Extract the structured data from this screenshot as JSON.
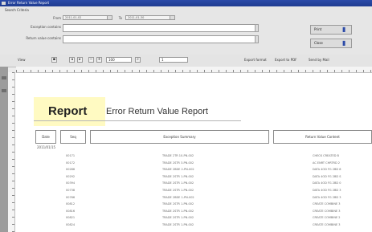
{
  "window": {
    "title": "Error Return Value Report"
  },
  "params": {
    "group_label": "Search Criteria",
    "from_label": "From",
    "from_value": "2011-01-02",
    "to_label": "To",
    "to_value": "2011-01-30",
    "exception_label": "Exception contains",
    "return_label": "Return value contains",
    "print_button": "Print",
    "close_button": "Close"
  },
  "toolbar": {
    "view_label": "View",
    "zoom_value": "100",
    "page_value": "1",
    "export_label": "Export format",
    "export_pdf": "Export to PDF",
    "send_label": "Send by Mail"
  },
  "report": {
    "badge": "Report",
    "title": "Error Return Value Report",
    "columns": [
      "Date",
      "Seq",
      "Exception Summary",
      "Return Value Content"
    ],
    "group": "2011/01/15",
    "rows": [
      {
        "seq": "00171",
        "exception": "TRADE 2TR 10-PN-002",
        "returned": "CHECK CREATED B"
      },
      {
        "seq": "00172",
        "exception": "TRADE 2STR 3-PN-002",
        "returned": "AC ENRT CHRTRD 2"
      },
      {
        "seq": "00286",
        "exception": "TRADE 2BDE 2-PN-002",
        "returned": "DATA 4OD FG 2BD 8"
      },
      {
        "seq": "00292",
        "exception": "TRADE 2STR 1-PN-002",
        "returned": "DATA 4OD FG 2BD S"
      },
      {
        "seq": "00394",
        "exception": "TRADE 2STR 1-PN-002",
        "returned": "DATA 4OD FG 2BD 0"
      },
      {
        "seq": "00738",
        "exception": "TRADE 2STR 1-PN-002",
        "returned": "DATA 4OD FG 2BD 3"
      },
      {
        "seq": "00766",
        "exception": "TRADE 2BDE 1-PN-002",
        "returned": "DATA 4OD FG 2BD 3"
      },
      {
        "seq": "00812",
        "exception": "TRADE 2STR 1-PN-002",
        "returned": "CREATE COMBINE 3"
      },
      {
        "seq": "00816",
        "exception": "TRADE 2STR 1-PN-002",
        "returned": "CREATE COMBINE 3"
      },
      {
        "seq": "00821",
        "exception": "TRADE 2STR 1-PN-002",
        "returned": "CREATE COMBINE 2"
      },
      {
        "seq": "00824",
        "exception": "TRADE 2STR 1-PN-002",
        "returned": "CREATE COMBINE 3"
      }
    ]
  }
}
